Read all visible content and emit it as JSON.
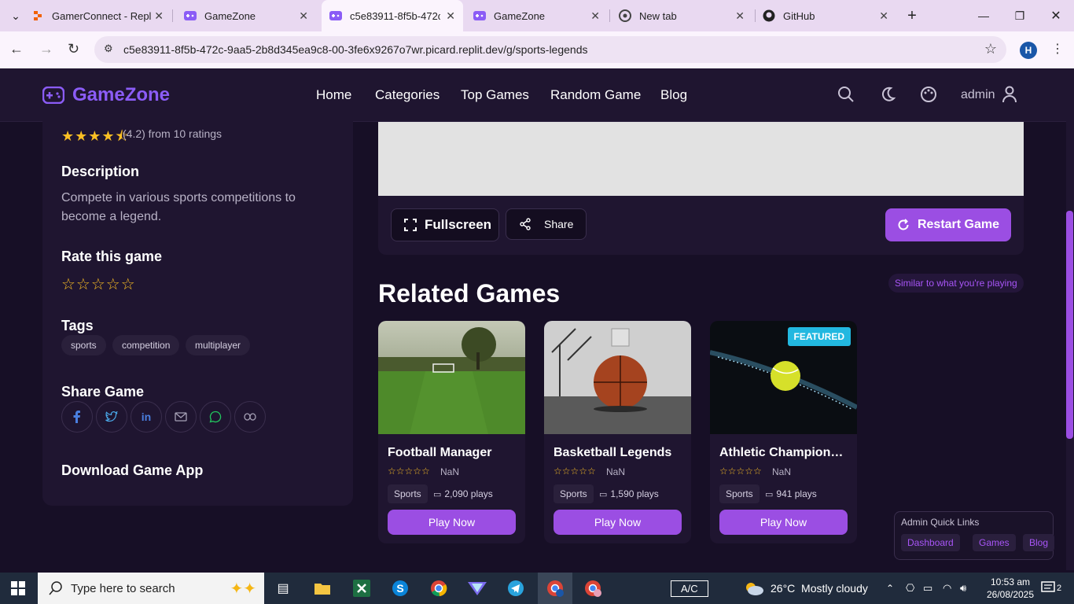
{
  "browser": {
    "tabs": [
      {
        "title": "GamerConnect - Repl",
        "icon": "replit-icon"
      },
      {
        "title": "GameZone",
        "icon": "gamepad-icon"
      },
      {
        "title": "c5e83911-8f5b-472c-",
        "icon": "gamepad-icon",
        "active": true
      },
      {
        "title": "GameZone",
        "icon": "gamepad-icon"
      },
      {
        "title": "New tab",
        "icon": "chrome-icon"
      },
      {
        "title": "GitHub",
        "icon": "github-icon"
      }
    ],
    "url": "c5e83911-8f5b-472c-9aa5-2b8d345ea9c8-00-3fe6x9267o7wr.picard.replit.dev/g/sports-legends",
    "profile_initial": "H"
  },
  "site": {
    "logo": "GameZone",
    "nav": [
      "Home",
      "Categories",
      "Top Games",
      "Random Game",
      "Blog"
    ],
    "user": "admin"
  },
  "sidebar": {
    "rating_text": "(4.2) from 10 ratings",
    "rating_stars": "★★★★⯪",
    "description_title": "Description",
    "description": "Compete in various sports competitions to become a legend.",
    "rate_title": "Rate this game",
    "rate_stars": "☆☆☆☆☆",
    "tags_title": "Tags",
    "tags": [
      "sports",
      "competition",
      "multiplayer"
    ],
    "share_title": "Share Game",
    "share_icons": [
      "facebook-icon",
      "twitter-icon",
      "linkedin-icon",
      "mail-icon",
      "whatsapp-icon",
      "link-icon"
    ],
    "download_title": "Download Game App"
  },
  "controls": {
    "fullscreen": "Fullscreen",
    "share": "Share",
    "restart": "Restart Game"
  },
  "related": {
    "title": "Related Games",
    "pill": "Similar to what you're playing",
    "games": [
      {
        "name": "Football Manager",
        "stars": "☆☆☆☆☆",
        "rating": "NaN",
        "category": "Sports",
        "plays": "2,090 plays",
        "play": "Play Now"
      },
      {
        "name": "Basketball Legends",
        "stars": "☆☆☆☆☆",
        "rating": "NaN",
        "category": "Sports",
        "plays": "1,590 plays",
        "play": "Play Now"
      },
      {
        "name": "Athletic Championship",
        "stars": "☆☆☆☆☆",
        "rating": "NaN",
        "category": "Sports",
        "plays": "941 plays",
        "play": "Play Now",
        "badge": "FEATURED"
      }
    ]
  },
  "quick_links": {
    "title": "Admin Quick Links",
    "links": [
      "Dashboard",
      "Games",
      "Blog"
    ]
  },
  "taskbar": {
    "search_placeholder": "Type here to search",
    "ac": "A/C",
    "weather": "26°C  Mostly cloudy",
    "time": "10:53 am",
    "date": "26/08/2025",
    "notifications": "2"
  },
  "colors": {
    "accent": "#9b4ee3",
    "background": "#170f26",
    "panel": "#1f1530",
    "star": "#fbbf24",
    "featured": "#22b8e0"
  }
}
